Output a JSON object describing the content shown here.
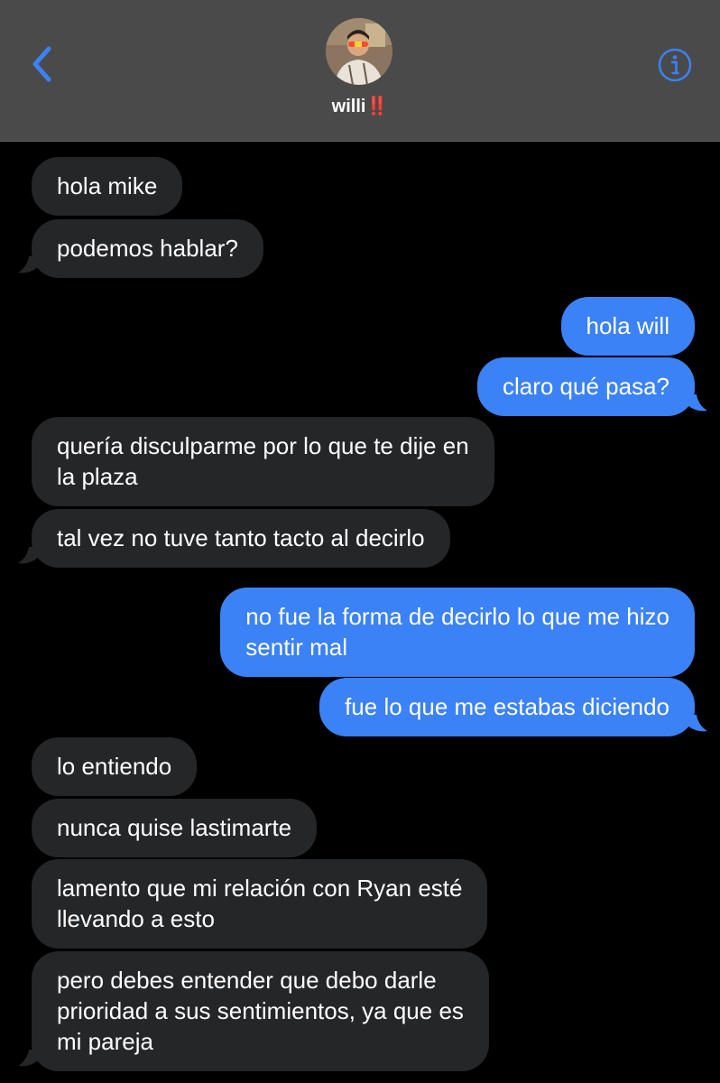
{
  "header": {
    "contact_name": "willi‼️",
    "accent": "#3b82f6",
    "back_icon": "chevron-left-icon",
    "info_icon": "info-icon"
  },
  "messages": [
    {
      "from": "them",
      "text": "hola mike"
    },
    {
      "from": "them",
      "text": "podemos hablar?"
    },
    {
      "from": "me",
      "text": "hola will"
    },
    {
      "from": "me",
      "text": "claro qué pasa?"
    },
    {
      "from": "them",
      "text": "quería disculparme por lo que te dije en\nla plaza"
    },
    {
      "from": "them",
      "text": "tal vez no tuve tanto tacto al decirlo"
    },
    {
      "from": "me",
      "text": "no fue la forma de decirlo lo que me hizo\nsentir mal"
    },
    {
      "from": "me",
      "text": "fue lo que me estabas diciendo"
    },
    {
      "from": "them",
      "text": "lo entiendo"
    },
    {
      "from": "them",
      "text": "nunca quise lastimarte"
    },
    {
      "from": "them",
      "text": "lamento que mi relación con Ryan esté\nllevando a esto"
    },
    {
      "from": "them",
      "text": "pero debes entender que debo darle\nprioridad a sus sentimientos, ya que es\nmi pareja"
    }
  ]
}
